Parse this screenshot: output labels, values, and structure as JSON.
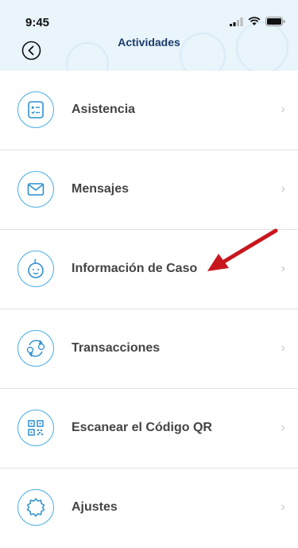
{
  "status_bar": {
    "time": "9:45",
    "signal_icon": "signal-bars-icon",
    "wifi_icon": "wifi-icon",
    "battery_icon": "battery-icon"
  },
  "header": {
    "title": "Actividades",
    "back_icon": "back-circle-icon",
    "background_color": "#e9f4fb",
    "title_color": "#1b3c6b"
  },
  "menu": {
    "accent_color": "#4fb0e4",
    "items": [
      {
        "label": "Asistencia",
        "icon": "attendance-list-icon"
      },
      {
        "label": "Mensajes",
        "icon": "envelope-icon"
      },
      {
        "label": "Información de Caso",
        "icon": "baby-face-icon"
      },
      {
        "label": "Transacciones",
        "icon": "exchange-people-icon"
      },
      {
        "label": "Escanear el Código QR",
        "icon": "qr-code-icon"
      },
      {
        "label": "Ajustes",
        "icon": "settings-gear-icon"
      }
    ]
  },
  "annotation": {
    "arrow_color": "#c8161d",
    "target": "Información de Caso"
  }
}
